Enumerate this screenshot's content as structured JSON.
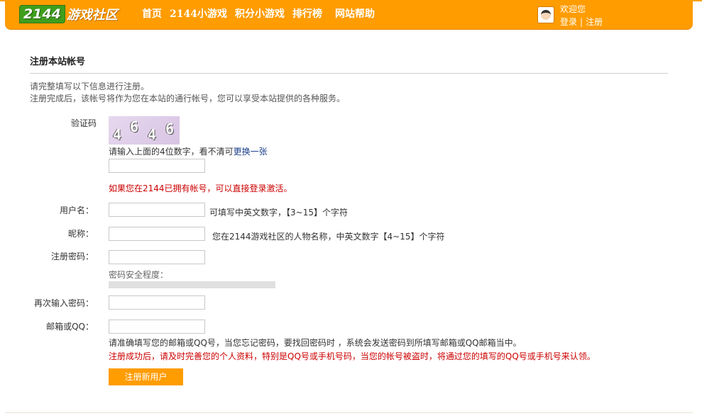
{
  "header": {
    "logo_number": "2144",
    "logo_text": "游戏社区",
    "nav": [
      "首页",
      "2144小游戏",
      "积分小游戏",
      "排行榜",
      "网站帮助"
    ],
    "welcome": "欢迎您",
    "login": "登录",
    "separator": "|",
    "register": "注册",
    "colors": {
      "bar": "#ff9c00",
      "logo_green": "#3f9e1e"
    }
  },
  "page": {
    "title": "注册本站帐号",
    "intro_line1": "请完整填写以下信息进行注册。",
    "intro_line2": "注册完成后，该帐号将作为您在本站的通行帐号，您可以享受本站提供的各种服务。"
  },
  "form": {
    "captcha": {
      "label": "验证码",
      "image_digits": [
        "4",
        "6",
        "4",
        "6"
      ],
      "hint_prefix": "请输入上面的4位数字，看不清可",
      "refresh_link": "更换一张",
      "value": "",
      "notice": "如果您在2144已拥有帐号，可以直接登录激活。"
    },
    "username": {
      "label": "用户名：",
      "value": "",
      "hint": "可填写中英文数字，【3~15】个字符"
    },
    "nickname": {
      "label": "昵称：",
      "value": "",
      "hint": "您在2144游戏社区的人物名称，中英文数字【4~15】个字符"
    },
    "password": {
      "label": "注册密码：",
      "value": "",
      "strength_label": "密码安全程度："
    },
    "password_confirm": {
      "label": "再次输入密码：",
      "value": ""
    },
    "email": {
      "label": "邮箱或QQ：",
      "value": "",
      "hint": "请准确填写您的邮箱或QQ号，当您忘记密码，要找回密码时 ，系统会发送密码到所填写邮箱或QQ邮箱当中。",
      "warning": "注册成功后，请及时完善您的个人资料，特别是QQ号或手机号码，当您的帐号被盗时，将通过您的填写的QQ号或手机号来认领。"
    },
    "submit_label": "注册新用户"
  }
}
